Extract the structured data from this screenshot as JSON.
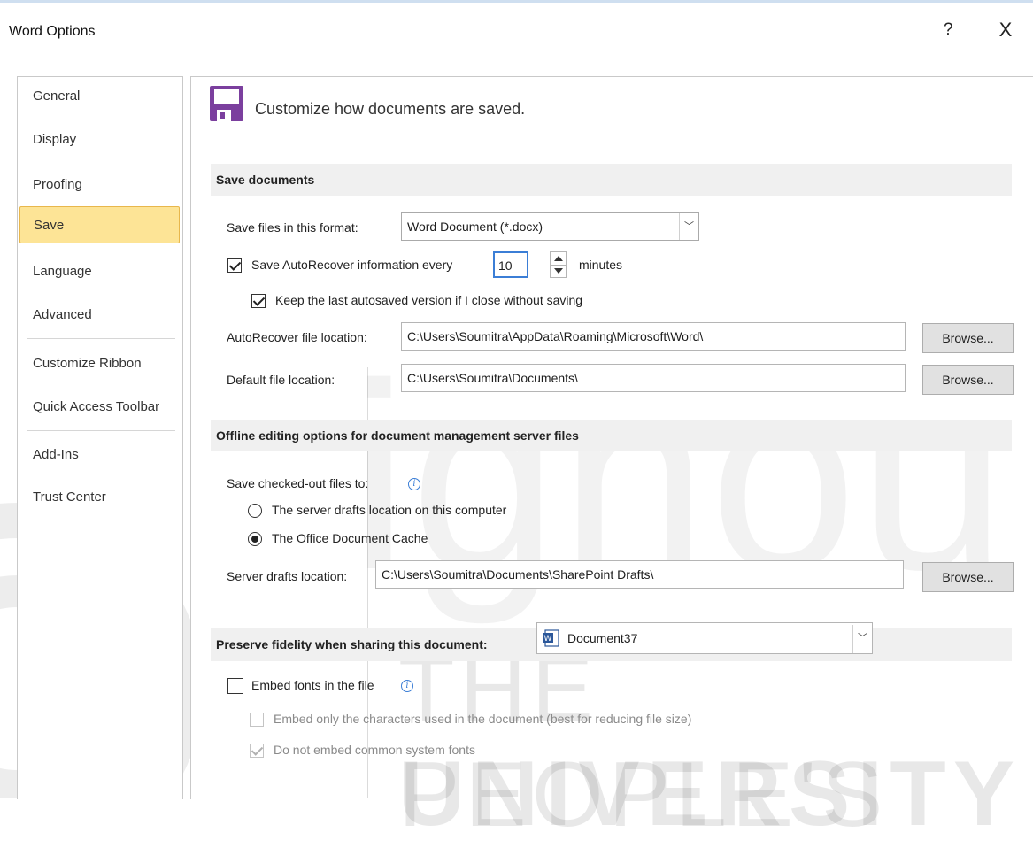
{
  "window": {
    "title": "Word Options",
    "help_glyph": "?",
    "close_glyph": "X"
  },
  "watermark": {
    "ignou": "ignou",
    "people": "THE PEOPLE'S",
    "university": "UNIVERSITY"
  },
  "sidebar": {
    "items": [
      {
        "label": "General"
      },
      {
        "label": "Display"
      },
      {
        "label": "Proofing"
      },
      {
        "label": "Save",
        "selected": true
      },
      {
        "label": "Language"
      },
      {
        "label": "Advanced"
      },
      {
        "label": "Customize Ribbon"
      },
      {
        "label": "Quick Access Toolbar"
      },
      {
        "label": "Add-Ins"
      },
      {
        "label": "Trust Center"
      }
    ]
  },
  "header": {
    "text": "Customize how documents are saved.",
    "icon": "floppy-disk-icon",
    "icon_color": "#7b3f9e"
  },
  "save_documents": {
    "heading": "Save documents",
    "format_label": "Save files in this format:",
    "format_value": "Word Document (*.docx)",
    "autorecover_label": "Save AutoRecover information every",
    "autorecover_checked": true,
    "autorecover_minutes": "10",
    "minutes_label": "minutes",
    "keep_last_label": "Keep the last autosaved version if I close without saving",
    "keep_last_checked": true,
    "autorecover_location_label": "AutoRecover file location:",
    "autorecover_location_value": "C:\\Users\\Soumitra\\AppData\\Roaming\\Microsoft\\Word\\",
    "default_location_label": "Default file location:",
    "default_location_value": "C:\\Users\\Soumitra\\Documents\\",
    "browse_label": "Browse..."
  },
  "offline": {
    "heading": "Offline editing options for document management server files",
    "checked_out_label": "Save checked-out files to:",
    "option_server": "The server drafts location on this computer",
    "option_cache": "The Office Document Cache",
    "selected_option": "cache",
    "server_drafts_label": "Server drafts location:",
    "server_drafts_value": "C:\\Users\\Soumitra\\Documents\\SharePoint Drafts\\",
    "browse_label": "Browse..."
  },
  "fidelity": {
    "heading": "Preserve fidelity when sharing this document:",
    "document_value": "Document37",
    "document_icon": "word-document-icon",
    "embed_fonts_label": "Embed fonts in the file",
    "embed_fonts_checked": false,
    "embed_only_label": "Embed only the characters used in the document (best for reducing file size)",
    "embed_only_checked": false,
    "no_common_label": "Do not embed common system fonts",
    "no_common_checked": true
  },
  "colors": {
    "selected_bg": "#fde496",
    "selected_border": "#e8b74c",
    "section_bg": "#f0f0f0",
    "info_blue": "#3b7ed6"
  }
}
